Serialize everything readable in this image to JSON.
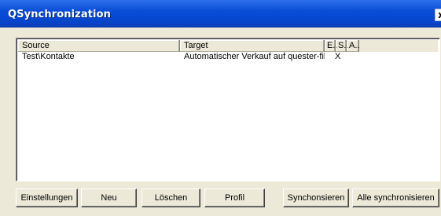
{
  "window": {
    "title": "QSynchronization",
    "close_label": "x"
  },
  "list": {
    "columns": [
      "Source",
      "Target",
      "E..",
      "S..",
      "A.."
    ],
    "rows": [
      {
        "source": "Test\\Kontakte",
        "target": "Automatischer Verkauf auf quester-fib...",
        "e": "X",
        "s": "",
        "a": ""
      }
    ]
  },
  "buttons": {
    "settings": "Einstellungen",
    "new": "Neu",
    "delete": "Löschen",
    "profile": "Profil",
    "sync": "Synchonsieren",
    "sync_all": "Alle synchronisieren"
  }
}
